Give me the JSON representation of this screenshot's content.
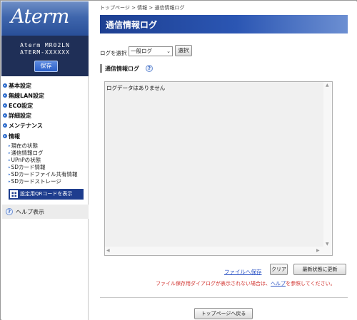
{
  "sidebar": {
    "logo": "Aterm",
    "model": "Aterm MR02LN",
    "device_id": "ATERM-XXXXXX",
    "save_label": "保存",
    "menu": {
      "basic": "基本設定",
      "wlan": "無線LAN設定",
      "eco": "ECO設定",
      "detail": "詳細設定",
      "maintenance": "メンテナンス",
      "info": "情報"
    },
    "info_items": [
      "現在の状態",
      "通信情報ログ",
      "UPnPの状態",
      "SDカード情報",
      "SDカードファイル共有情報",
      "SDカードストレージ"
    ],
    "qr_label": "設定用QRコードを表示",
    "help_label": "ヘルプ表示"
  },
  "main": {
    "breadcrumb": "トップページ > 情報 > 通信情報ログ",
    "title": "通信情報ログ",
    "log_select_label": "ログを選択",
    "log_select_value": "一般ログ",
    "select_button": "選択",
    "section_title": "通信情報ログ",
    "log_text": "ログデータはありません",
    "file_save_link": "ファイルへ保存",
    "clear_button": "クリア",
    "refresh_button": "最新状態に更新",
    "warning_before": "ファイル保存用ダイアログが表示されない場合は、",
    "warning_link": "ヘルプ",
    "warning_after": "を参照してください。",
    "back_button": "トップページへ戻る"
  },
  "icons": {
    "help": "?",
    "dropdown": "chevron-down-icon"
  },
  "colors": {
    "title_bar": "#1d3f91",
    "sidebar_model_bg": "#1f2f57",
    "warning": "#d0312d",
    "link": "#2a52c4"
  }
}
